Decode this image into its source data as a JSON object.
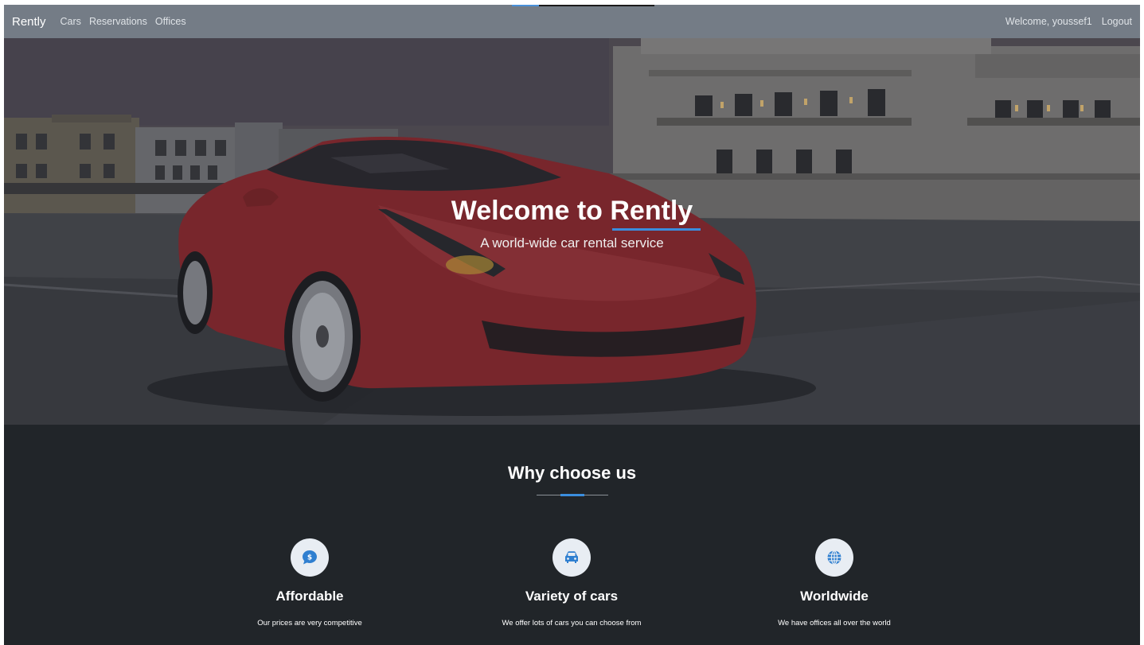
{
  "navbar": {
    "brand": "Rently",
    "links": [
      "Cars",
      "Reservations",
      "Offices"
    ],
    "welcome": "Welcome, youssef1",
    "logout": "Logout"
  },
  "hero": {
    "title": "Welcome to Rently",
    "subtitle": "A world-wide car rental service"
  },
  "why": {
    "title": "Why choose us",
    "features": [
      {
        "icon": "dollar-chat-icon",
        "title": "Affordable",
        "text": "Our prices are very competitive"
      },
      {
        "icon": "car-icon",
        "title": "Variety of cars",
        "text": "We offer lots of cars you can choose from"
      },
      {
        "icon": "globe-icon",
        "title": "Worldwide",
        "text": "We have offices all over the world"
      }
    ]
  },
  "colors": {
    "navbar": "#747c86",
    "accent": "#3b8ede",
    "section_bg": "#212529",
    "car": "#8e2a30"
  }
}
